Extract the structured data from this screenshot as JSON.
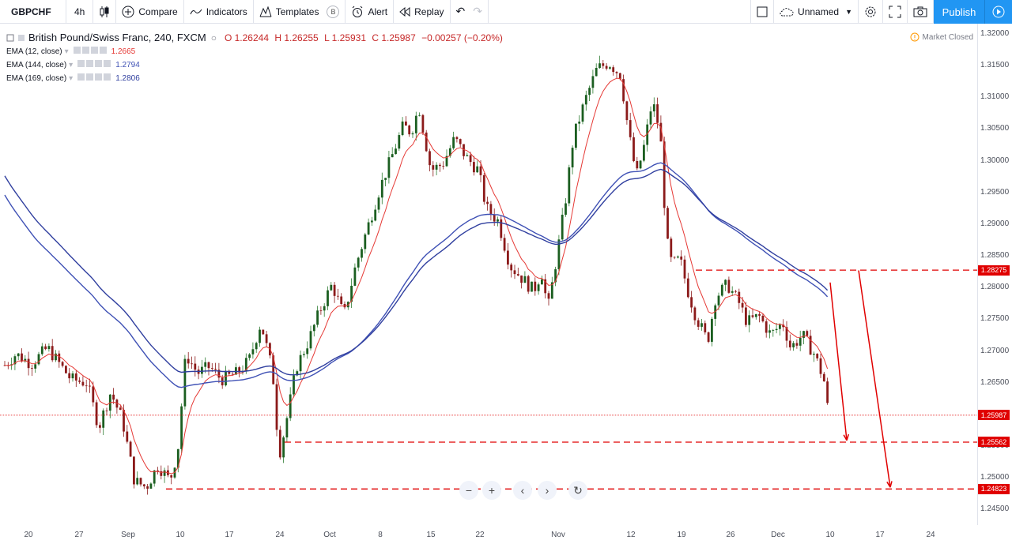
{
  "toolbar": {
    "symbol": "GBPCHF",
    "interval": "4h",
    "compare": "Compare",
    "indicators": "Indicators",
    "templates": "Templates",
    "templates_badge": "B",
    "alert": "Alert",
    "replay": "Replay",
    "layout_name": "Unnamed",
    "publish": "Publish"
  },
  "legend": {
    "title": "British Pound/Swiss Franc, 240, FXCM",
    "open": "O 1.26244",
    "high": "H 1.26255",
    "low": "L 1.25931",
    "close": "C 1.25987",
    "change": "−0.00257 (−0.20%)",
    "emas": [
      {
        "label": "EMA (12, close)",
        "value": "1.2665",
        "color": "#e53935"
      },
      {
        "label": "EMA (144, close)",
        "value": "1.2794",
        "color": "#3f51b5"
      },
      {
        "label": "EMA (169, close)",
        "value": "1.2806",
        "color": "#303f9f"
      }
    ]
  },
  "market_status": "Market Closed",
  "price_axis": [
    "1.32000",
    "1.31500",
    "1.31000",
    "1.30500",
    "1.30000",
    "1.29500",
    "1.29000",
    "1.28500",
    "1.28000",
    "1.27500",
    "1.27000",
    "1.26500",
    "1.26000",
    "1.25500",
    "1.25000",
    "1.24500"
  ],
  "price_tags": {
    "level1": "1.28275",
    "current": "1.25987",
    "level2": "1.25562",
    "level3": "1.24823"
  },
  "date_axis": [
    "20",
    "27",
    "Sep",
    "10",
    "17",
    "24",
    "Oct",
    "8",
    "15",
    "22",
    "Nov",
    "12",
    "19",
    "26",
    "Dec",
    "10",
    "17",
    "24"
  ],
  "colors": {
    "up": "#27a69a",
    "down": "#ef5350",
    "candle_body_up": "#1b5e20",
    "candle_body_down": "#8b1a1a",
    "annotation": "#e00000",
    "accent": "#2196f3"
  },
  "chart_data": {
    "type": "candlestick",
    "series": [
      {
        "name": "EMA (12, close)",
        "values": []
      },
      {
        "name": "EMA (144, close)",
        "values": []
      },
      {
        "name": "EMA (169, close)",
        "values": []
      }
    ],
    "horizontal_levels": [
      1.28275,
      1.25562,
      1.24823
    ],
    "last_price": 1.25987,
    "ylim": [
      1.243,
      1.322
    ],
    "close_path": [
      [
        0,
        1.267
      ],
      [
        20,
        1.2695
      ],
      [
        40,
        1.268
      ],
      [
        60,
        1.2705
      ],
      [
        75,
        1.268
      ],
      [
        90,
        1.2655
      ],
      [
        110,
        1.265
      ],
      [
        125,
        1.258
      ],
      [
        140,
        1.2635
      ],
      [
        155,
        1.259
      ],
      [
        170,
        1.2495
      ],
      [
        185,
        1.2485
      ],
      [
        200,
        1.252
      ],
      [
        215,
        1.2495
      ],
      [
        225,
        1.2545
      ],
      [
        235,
        1.2695
      ],
      [
        250,
        1.2665
      ],
      [
        265,
        1.2675
      ],
      [
        280,
        1.2655
      ],
      [
        300,
        1.2665
      ],
      [
        315,
        1.2685
      ],
      [
        330,
        1.2745
      ],
      [
        345,
        1.2665
      ],
      [
        353,
        1.2535
      ],
      [
        360,
        1.2575
      ],
      [
        375,
        1.2675
      ],
      [
        390,
        1.2715
      ],
      [
        405,
        1.2765
      ],
      [
        420,
        1.2805
      ],
      [
        435,
        1.2755
      ],
      [
        450,
        1.2835
      ],
      [
        465,
        1.2895
      ],
      [
        480,
        1.2955
      ],
      [
        495,
        1.3005
      ],
      [
        510,
        1.3055
      ],
      [
        520,
        1.3045
      ],
      [
        530,
        1.3085
      ],
      [
        545,
        1.2985
      ],
      [
        560,
        1.2995
      ],
      [
        575,
        1.3035
      ],
      [
        590,
        1.3005
      ],
      [
        605,
        1.2985
      ],
      [
        615,
        1.2925
      ],
      [
        630,
        1.2905
      ],
      [
        645,
        1.2835
      ],
      [
        660,
        1.2815
      ],
      [
        675,
        1.2795
      ],
      [
        685,
        1.2825
      ],
      [
        693,
        1.2765
      ],
      [
        705,
        1.2855
      ],
      [
        715,
        1.2935
      ],
      [
        725,
        1.3035
      ],
      [
        740,
        1.3095
      ],
      [
        755,
        1.3145
      ],
      [
        770,
        1.3155
      ],
      [
        785,
        1.3135
      ],
      [
        795,
        1.3045
      ],
      [
        805,
        1.2975
      ],
      [
        815,
        1.3025
      ],
      [
        825,
        1.3095
      ],
      [
        835,
        1.3045
      ],
      [
        843,
        1.2875
      ],
      [
        850,
        1.2835
      ],
      [
        860,
        1.2845
      ],
      [
        870,
        1.2795
      ],
      [
        880,
        1.2755
      ],
      [
        895,
        1.2715
      ],
      [
        905,
        1.2785
      ],
      [
        920,
        1.2805
      ],
      [
        935,
        1.2775
      ],
      [
        945,
        1.2745
      ],
      [
        960,
        1.2755
      ],
      [
        975,
        1.2725
      ],
      [
        990,
        1.2745
      ],
      [
        1000,
        1.2705
      ],
      [
        1015,
        1.2725
      ],
      [
        1030,
        1.2695
      ],
      [
        1042,
        1.2655
      ],
      [
        1048,
        1.2599
      ]
    ]
  }
}
